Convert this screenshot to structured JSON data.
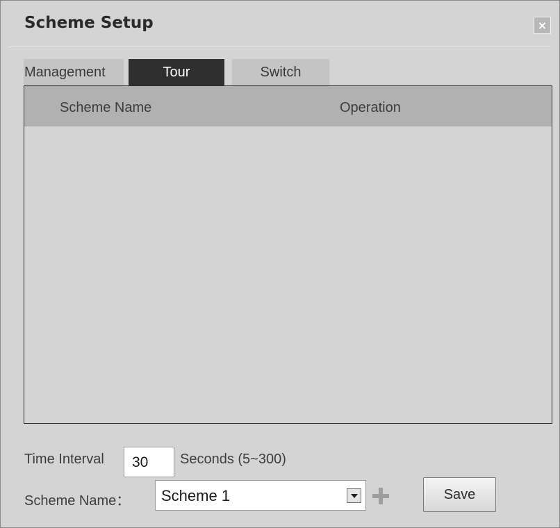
{
  "dialog": {
    "title": "Scheme Setup",
    "close_glyph": "×"
  },
  "tabs": [
    {
      "label": "Management",
      "active": false
    },
    {
      "label": "Tour",
      "active": true
    },
    {
      "label": "Switch",
      "active": false
    }
  ],
  "table": {
    "columns": [
      "Scheme Name",
      "Operation"
    ],
    "rows": []
  },
  "form": {
    "interval_label": "Time Interval",
    "interval_value": "30",
    "interval_unit": "Seconds (5~300)",
    "scheme_label": "Scheme Name：",
    "scheme_value": "Scheme 1",
    "save_label": "Save"
  },
  "icons": {
    "close": "close-icon",
    "dropdown": "chevron-down-icon",
    "add": "plus-icon"
  },
  "colors": {
    "active_tab": "#2f2f2f",
    "inactive_tab": "#c4c4c4",
    "table_header": "#b1b1b1",
    "background": "#d4d4d4"
  }
}
